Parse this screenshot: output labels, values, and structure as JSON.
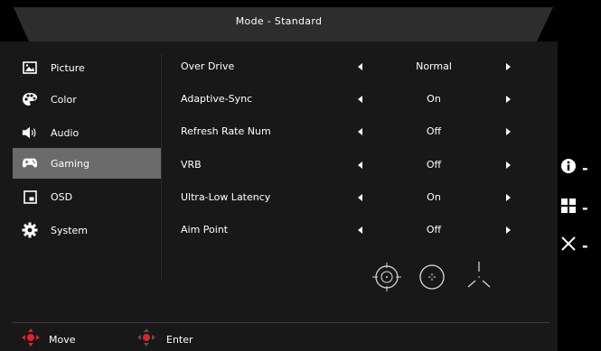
{
  "header": {
    "title": "Mode - Standard"
  },
  "sidebar": {
    "items": [
      {
        "label": "Picture",
        "icon": "picture-icon"
      },
      {
        "label": "Color",
        "icon": "palette-icon"
      },
      {
        "label": "Audio",
        "icon": "speaker-icon"
      },
      {
        "label": "Gaming",
        "icon": "gamepad-icon",
        "active": true
      },
      {
        "label": "OSD",
        "icon": "osd-window-icon"
      },
      {
        "label": "System",
        "icon": "gear-icon"
      }
    ]
  },
  "settings": [
    {
      "label": "Over Drive",
      "value": "Normal"
    },
    {
      "label": "Adaptive-Sync",
      "value": "On"
    },
    {
      "label": "Refresh Rate Num",
      "value": "Off"
    },
    {
      "label": "VRB",
      "value": "Off"
    },
    {
      "label": "Ultra-Low Latency",
      "value": "On"
    },
    {
      "label": "Aim Point",
      "value": "Off"
    }
  ],
  "aim_point_options": [
    "crosshair-circle-icon",
    "crosshair-dot-icon",
    "crosshair-tripod-icon"
  ],
  "footer": {
    "move_label": "Move",
    "enter_label": "Enter"
  },
  "hotkeys": [
    "info-icon",
    "grid-icon",
    "close-icon"
  ],
  "colors": {
    "active_item": "#6b6b6b",
    "panel": "#181818",
    "titlebar": "#2b2b2b",
    "nav_red": "#e0202a"
  }
}
